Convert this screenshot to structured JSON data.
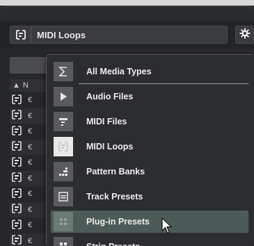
{
  "media_select": {
    "label": "MIDI Loops",
    "icon": "midi-loop-icon"
  },
  "settings": {
    "icon": "gear-icon"
  },
  "left_column": {
    "header": "▲ N",
    "rows": [
      "€",
      "€",
      "€",
      "€",
      "€",
      "€",
      "€",
      "€",
      "€",
      "€"
    ]
  },
  "menu": {
    "items": [
      {
        "label": "All Media Types",
        "icon": "sigma-icon",
        "state": "normal"
      },
      {
        "label": "Audio Files",
        "icon": "audio-file-icon",
        "state": "normal"
      },
      {
        "label": "MIDI Files",
        "icon": "midi-file-icon",
        "state": "normal"
      },
      {
        "label": "MIDI Loops",
        "icon": "midi-loop-icon",
        "state": "selected"
      },
      {
        "label": "Pattern Banks",
        "icon": "pattern-bank-icon",
        "state": "normal"
      },
      {
        "label": "Track Presets",
        "icon": "track-preset-icon",
        "state": "normal"
      },
      {
        "label": "Plug-in Presets",
        "icon": "plugin-preset-icon",
        "state": "hover"
      },
      {
        "label": "Strip Presets",
        "icon": "strip-preset-icon",
        "state": "normal"
      }
    ]
  },
  "colors": {
    "highlight": "#4d5b58",
    "icon_bg": "#5a5b5f",
    "selected_icon_bg": "#e9e9e9"
  }
}
